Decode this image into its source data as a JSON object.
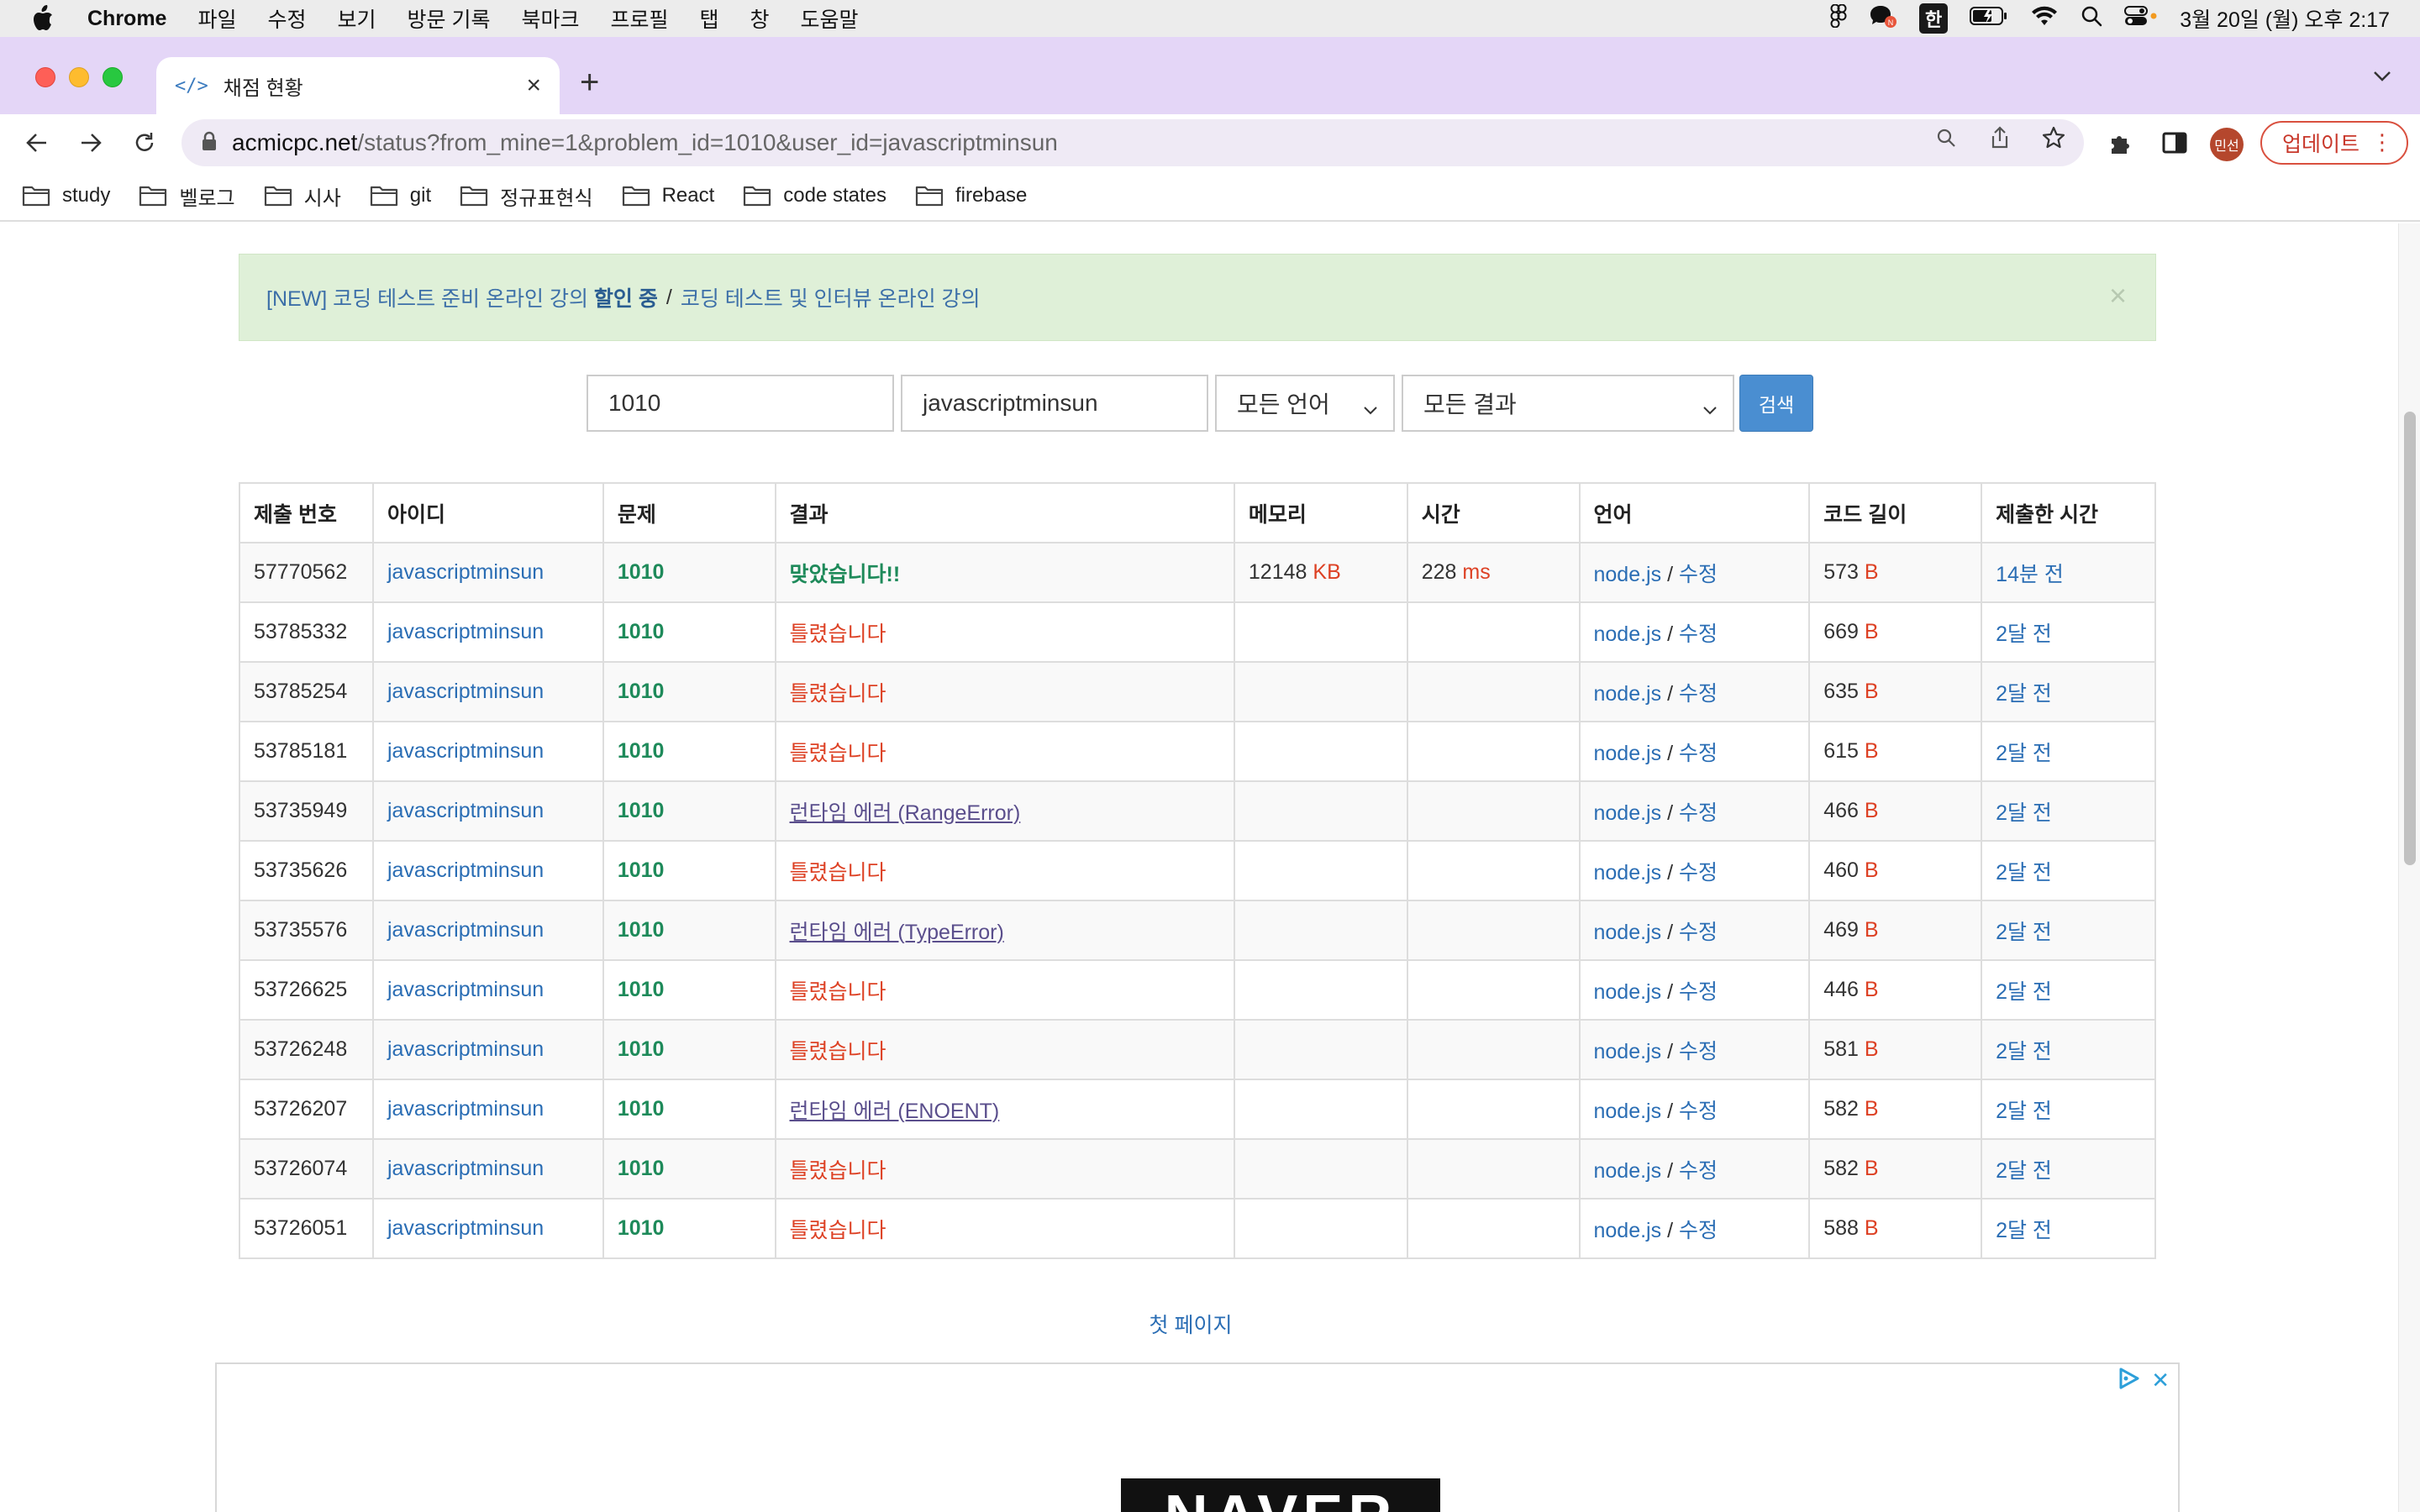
{
  "menubar": {
    "app_name": "Chrome",
    "items": [
      "파일",
      "수정",
      "보기",
      "방문 기록",
      "북마크",
      "프로필",
      "탭",
      "창",
      "도움말"
    ],
    "ime_label": "한",
    "clock": "3월 20일 (월) 오후 2:17"
  },
  "tab": {
    "title": "채점 현황",
    "favicon": "</>"
  },
  "omnibox": {
    "host": "acmicpc.net",
    "path": "/status?from_mine=1&problem_id=1010&user_id=javascriptminsun"
  },
  "profile": {
    "initials": "민선",
    "update_label": "업데이트"
  },
  "bookmarks": [
    "study",
    "벨로그",
    "시사",
    "git",
    "정규표현식",
    "React",
    "code states",
    "firebase"
  ],
  "alert": {
    "prefix": "[NEW] 코딩 테스트 준비 온라인 강의 ",
    "bold": "할인 중",
    "separator": "/",
    "suffix": "코딩 테스트 및 인터뷰 온라인 강의",
    "close": "×"
  },
  "search": {
    "problem_id": "1010",
    "user_id": "javascriptminsun",
    "language": "모든 언어",
    "result": "모든 결과",
    "button": "검색"
  },
  "table": {
    "headers": [
      "제출 번호",
      "아이디",
      "문제",
      "결과",
      "메모리",
      "시간",
      "언어",
      "코드 길이",
      "제출한 시간"
    ],
    "rows": [
      {
        "id": "57770562",
        "user": "javascriptminsun",
        "problem": "1010",
        "result": "맞았습니다!!",
        "result_type": "ac",
        "memory": "12148",
        "memory_unit": "KB",
        "time": "228",
        "time_unit": "ms",
        "lang": "node.js",
        "edit": "수정",
        "length": "573",
        "length_unit": "B",
        "submitted": "14분 전"
      },
      {
        "id": "53785332",
        "user": "javascriptminsun",
        "problem": "1010",
        "result": "틀렸습니다",
        "result_type": "wa",
        "memory": "",
        "memory_unit": "",
        "time": "",
        "time_unit": "",
        "lang": "node.js",
        "edit": "수정",
        "length": "669",
        "length_unit": "B",
        "submitted": "2달 전"
      },
      {
        "id": "53785254",
        "user": "javascriptminsun",
        "problem": "1010",
        "result": "틀렸습니다",
        "result_type": "wa",
        "memory": "",
        "memory_unit": "",
        "time": "",
        "time_unit": "",
        "lang": "node.js",
        "edit": "수정",
        "length": "635",
        "length_unit": "B",
        "submitted": "2달 전"
      },
      {
        "id": "53785181",
        "user": "javascriptminsun",
        "problem": "1010",
        "result": "틀렸습니다",
        "result_type": "wa",
        "memory": "",
        "memory_unit": "",
        "time": "",
        "time_unit": "",
        "lang": "node.js",
        "edit": "수정",
        "length": "615",
        "length_unit": "B",
        "submitted": "2달 전"
      },
      {
        "id": "53735949",
        "user": "javascriptminsun",
        "problem": "1010",
        "result": "런타임 에러 (RangeError)",
        "result_type": "rte",
        "memory": "",
        "memory_unit": "",
        "time": "",
        "time_unit": "",
        "lang": "node.js",
        "edit": "수정",
        "length": "466",
        "length_unit": "B",
        "submitted": "2달 전"
      },
      {
        "id": "53735626",
        "user": "javascriptminsun",
        "problem": "1010",
        "result": "틀렸습니다",
        "result_type": "wa",
        "memory": "",
        "memory_unit": "",
        "time": "",
        "time_unit": "",
        "lang": "node.js",
        "edit": "수정",
        "length": "460",
        "length_unit": "B",
        "submitted": "2달 전"
      },
      {
        "id": "53735576",
        "user": "javascriptminsun",
        "problem": "1010",
        "result": "런타임 에러 (TypeError)",
        "result_type": "rte",
        "memory": "",
        "memory_unit": "",
        "time": "",
        "time_unit": "",
        "lang": "node.js",
        "edit": "수정",
        "length": "469",
        "length_unit": "B",
        "submitted": "2달 전"
      },
      {
        "id": "53726625",
        "user": "javascriptminsun",
        "problem": "1010",
        "result": "틀렸습니다",
        "result_type": "wa",
        "memory": "",
        "memory_unit": "",
        "time": "",
        "time_unit": "",
        "lang": "node.js",
        "edit": "수정",
        "length": "446",
        "length_unit": "B",
        "submitted": "2달 전"
      },
      {
        "id": "53726248",
        "user": "javascriptminsun",
        "problem": "1010",
        "result": "틀렸습니다",
        "result_type": "wa",
        "memory": "",
        "memory_unit": "",
        "time": "",
        "time_unit": "",
        "lang": "node.js",
        "edit": "수정",
        "length": "581",
        "length_unit": "B",
        "submitted": "2달 전"
      },
      {
        "id": "53726207",
        "user": "javascriptminsun",
        "problem": "1010",
        "result": "런타임 에러 (ENOENT)",
        "result_type": "rte",
        "memory": "",
        "memory_unit": "",
        "time": "",
        "time_unit": "",
        "lang": "node.js",
        "edit": "수정",
        "length": "582",
        "length_unit": "B",
        "submitted": "2달 전"
      },
      {
        "id": "53726074",
        "user": "javascriptminsun",
        "problem": "1010",
        "result": "틀렸습니다",
        "result_type": "wa",
        "memory": "",
        "memory_unit": "",
        "time": "",
        "time_unit": "",
        "lang": "node.js",
        "edit": "수정",
        "length": "582",
        "length_unit": "B",
        "submitted": "2달 전"
      },
      {
        "id": "53726051",
        "user": "javascriptminsun",
        "problem": "1010",
        "result": "틀렸습니다",
        "result_type": "wa",
        "memory": "",
        "memory_unit": "",
        "time": "",
        "time_unit": "",
        "lang": "node.js",
        "edit": "수정",
        "length": "588",
        "length_unit": "B",
        "submitted": "2달 전"
      }
    ]
  },
  "pagination": {
    "first_page": "첫 페이지"
  },
  "ad": {
    "logo_text": "NAVER",
    "close": "✕"
  },
  "colors": {
    "tabstrip": "#e4d6f7",
    "link": "#2a6db4",
    "accepted": "#1e8a5a",
    "wrong": "#dd4124",
    "runtime_error": "#5a4e8c",
    "search_button": "#4a8ed1",
    "alert_bg": "#dff0d8"
  },
  "icons": {
    "menubar_status": [
      "figma-icon",
      "messenger-icon",
      "battery-icon",
      "wifi-icon",
      "spotlight-search-icon",
      "control-center-icon"
    ],
    "toolbar": [
      "back-arrow-icon",
      "forward-arrow-icon",
      "reload-icon",
      "lock-icon",
      "zoom-search-icon",
      "share-icon",
      "bookmark-star-icon",
      "extensions-puzzle-icon",
      "side-panel-icon",
      "more-vertical-icon"
    ],
    "bookmark_item": "folder-icon"
  }
}
